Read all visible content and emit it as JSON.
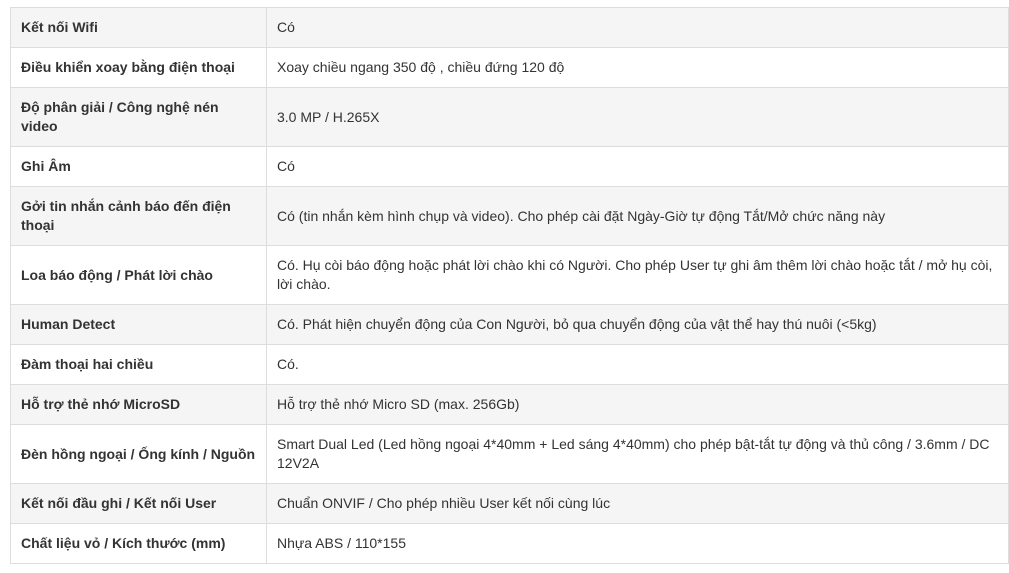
{
  "spec_table": {
    "rows": [
      {
        "label": "Kết nối Wifi",
        "value": "Có"
      },
      {
        "label": "Điều khiển xoay bằng điện thoại",
        "value": "Xoay chiều ngang 350 độ , chiều đứng 120 độ"
      },
      {
        "label": "Độ phân giải / Công nghệ nén video",
        "value": "3.0 MP / H.265X"
      },
      {
        "label": "Ghi Âm",
        "value": "Có"
      },
      {
        "label": "Gởi tin nhắn cảnh báo đến điện thoại",
        "value": "Có (tin nhắn kèm hình chụp và video). Cho phép cài đặt Ngày-Giờ tự động Tắt/Mở chức năng này"
      },
      {
        "label": "Loa báo động / Phát lời chào",
        "value": "Có. Hụ còi báo động hoặc phát lời chào khi có Người. Cho phép User tự ghi âm thêm lời chào hoặc tắt / mở hụ còi, lời chào."
      },
      {
        "label": "Human Detect",
        "value": "Có. Phát hiện chuyển động của Con Người, bỏ qua chuyển động của vật thể hay thú nuôi (<5kg)"
      },
      {
        "label": "Đàm thoại hai chiều",
        "value": "Có."
      },
      {
        "label": "Hỗ trợ thẻ nhớ MicroSD",
        "value": "Hỗ trợ thẻ nhớ Micro SD (max. 256Gb)"
      },
      {
        "label": "Đèn hồng ngoại / Ống kính / Nguồn",
        "value": "Smart Dual Led (Led hồng ngoại 4*40mm + Led sáng 4*40mm) cho phép bật-tắt tự động và thủ công / 3.6mm / DC 12V2A"
      },
      {
        "label": "Kết nối đầu ghi / Kết nối User",
        "value": "Chuẩn ONVIF / Cho phép nhiều User kết nối cùng lúc"
      },
      {
        "label": "Chất liệu vỏ / Kích thước (mm)",
        "value": "Nhựa ABS / 110*155"
      }
    ]
  }
}
